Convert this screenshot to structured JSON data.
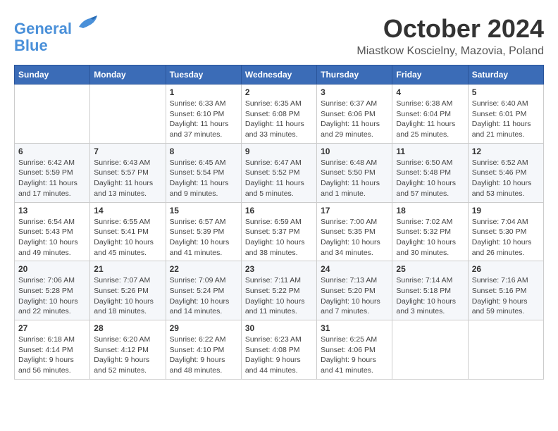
{
  "header": {
    "logo_line1": "General",
    "logo_line2": "Blue",
    "month": "October 2024",
    "location": "Miastkow Koscielny, Mazovia, Poland"
  },
  "weekdays": [
    "Sunday",
    "Monday",
    "Tuesday",
    "Wednesday",
    "Thursday",
    "Friday",
    "Saturday"
  ],
  "weeks": [
    [
      {
        "day": "",
        "info": ""
      },
      {
        "day": "",
        "info": ""
      },
      {
        "day": "1",
        "info": "Sunrise: 6:33 AM\nSunset: 6:10 PM\nDaylight: 11 hours and 37 minutes."
      },
      {
        "day": "2",
        "info": "Sunrise: 6:35 AM\nSunset: 6:08 PM\nDaylight: 11 hours and 33 minutes."
      },
      {
        "day": "3",
        "info": "Sunrise: 6:37 AM\nSunset: 6:06 PM\nDaylight: 11 hours and 29 minutes."
      },
      {
        "day": "4",
        "info": "Sunrise: 6:38 AM\nSunset: 6:04 PM\nDaylight: 11 hours and 25 minutes."
      },
      {
        "day": "5",
        "info": "Sunrise: 6:40 AM\nSunset: 6:01 PM\nDaylight: 11 hours and 21 minutes."
      }
    ],
    [
      {
        "day": "6",
        "info": "Sunrise: 6:42 AM\nSunset: 5:59 PM\nDaylight: 11 hours and 17 minutes."
      },
      {
        "day": "7",
        "info": "Sunrise: 6:43 AM\nSunset: 5:57 PM\nDaylight: 11 hours and 13 minutes."
      },
      {
        "day": "8",
        "info": "Sunrise: 6:45 AM\nSunset: 5:54 PM\nDaylight: 11 hours and 9 minutes."
      },
      {
        "day": "9",
        "info": "Sunrise: 6:47 AM\nSunset: 5:52 PM\nDaylight: 11 hours and 5 minutes."
      },
      {
        "day": "10",
        "info": "Sunrise: 6:48 AM\nSunset: 5:50 PM\nDaylight: 11 hours and 1 minute."
      },
      {
        "day": "11",
        "info": "Sunrise: 6:50 AM\nSunset: 5:48 PM\nDaylight: 10 hours and 57 minutes."
      },
      {
        "day": "12",
        "info": "Sunrise: 6:52 AM\nSunset: 5:46 PM\nDaylight: 10 hours and 53 minutes."
      }
    ],
    [
      {
        "day": "13",
        "info": "Sunrise: 6:54 AM\nSunset: 5:43 PM\nDaylight: 10 hours and 49 minutes."
      },
      {
        "day": "14",
        "info": "Sunrise: 6:55 AM\nSunset: 5:41 PM\nDaylight: 10 hours and 45 minutes."
      },
      {
        "day": "15",
        "info": "Sunrise: 6:57 AM\nSunset: 5:39 PM\nDaylight: 10 hours and 41 minutes."
      },
      {
        "day": "16",
        "info": "Sunrise: 6:59 AM\nSunset: 5:37 PM\nDaylight: 10 hours and 38 minutes."
      },
      {
        "day": "17",
        "info": "Sunrise: 7:00 AM\nSunset: 5:35 PM\nDaylight: 10 hours and 34 minutes."
      },
      {
        "day": "18",
        "info": "Sunrise: 7:02 AM\nSunset: 5:32 PM\nDaylight: 10 hours and 30 minutes."
      },
      {
        "day": "19",
        "info": "Sunrise: 7:04 AM\nSunset: 5:30 PM\nDaylight: 10 hours and 26 minutes."
      }
    ],
    [
      {
        "day": "20",
        "info": "Sunrise: 7:06 AM\nSunset: 5:28 PM\nDaylight: 10 hours and 22 minutes."
      },
      {
        "day": "21",
        "info": "Sunrise: 7:07 AM\nSunset: 5:26 PM\nDaylight: 10 hours and 18 minutes."
      },
      {
        "day": "22",
        "info": "Sunrise: 7:09 AM\nSunset: 5:24 PM\nDaylight: 10 hours and 14 minutes."
      },
      {
        "day": "23",
        "info": "Sunrise: 7:11 AM\nSunset: 5:22 PM\nDaylight: 10 hours and 11 minutes."
      },
      {
        "day": "24",
        "info": "Sunrise: 7:13 AM\nSunset: 5:20 PM\nDaylight: 10 hours and 7 minutes."
      },
      {
        "day": "25",
        "info": "Sunrise: 7:14 AM\nSunset: 5:18 PM\nDaylight: 10 hours and 3 minutes."
      },
      {
        "day": "26",
        "info": "Sunrise: 7:16 AM\nSunset: 5:16 PM\nDaylight: 9 hours and 59 minutes."
      }
    ],
    [
      {
        "day": "27",
        "info": "Sunrise: 6:18 AM\nSunset: 4:14 PM\nDaylight: 9 hours and 56 minutes."
      },
      {
        "day": "28",
        "info": "Sunrise: 6:20 AM\nSunset: 4:12 PM\nDaylight: 9 hours and 52 minutes."
      },
      {
        "day": "29",
        "info": "Sunrise: 6:22 AM\nSunset: 4:10 PM\nDaylight: 9 hours and 48 minutes."
      },
      {
        "day": "30",
        "info": "Sunrise: 6:23 AM\nSunset: 4:08 PM\nDaylight: 9 hours and 44 minutes."
      },
      {
        "day": "31",
        "info": "Sunrise: 6:25 AM\nSunset: 4:06 PM\nDaylight: 9 hours and 41 minutes."
      },
      {
        "day": "",
        "info": ""
      },
      {
        "day": "",
        "info": ""
      }
    ]
  ]
}
